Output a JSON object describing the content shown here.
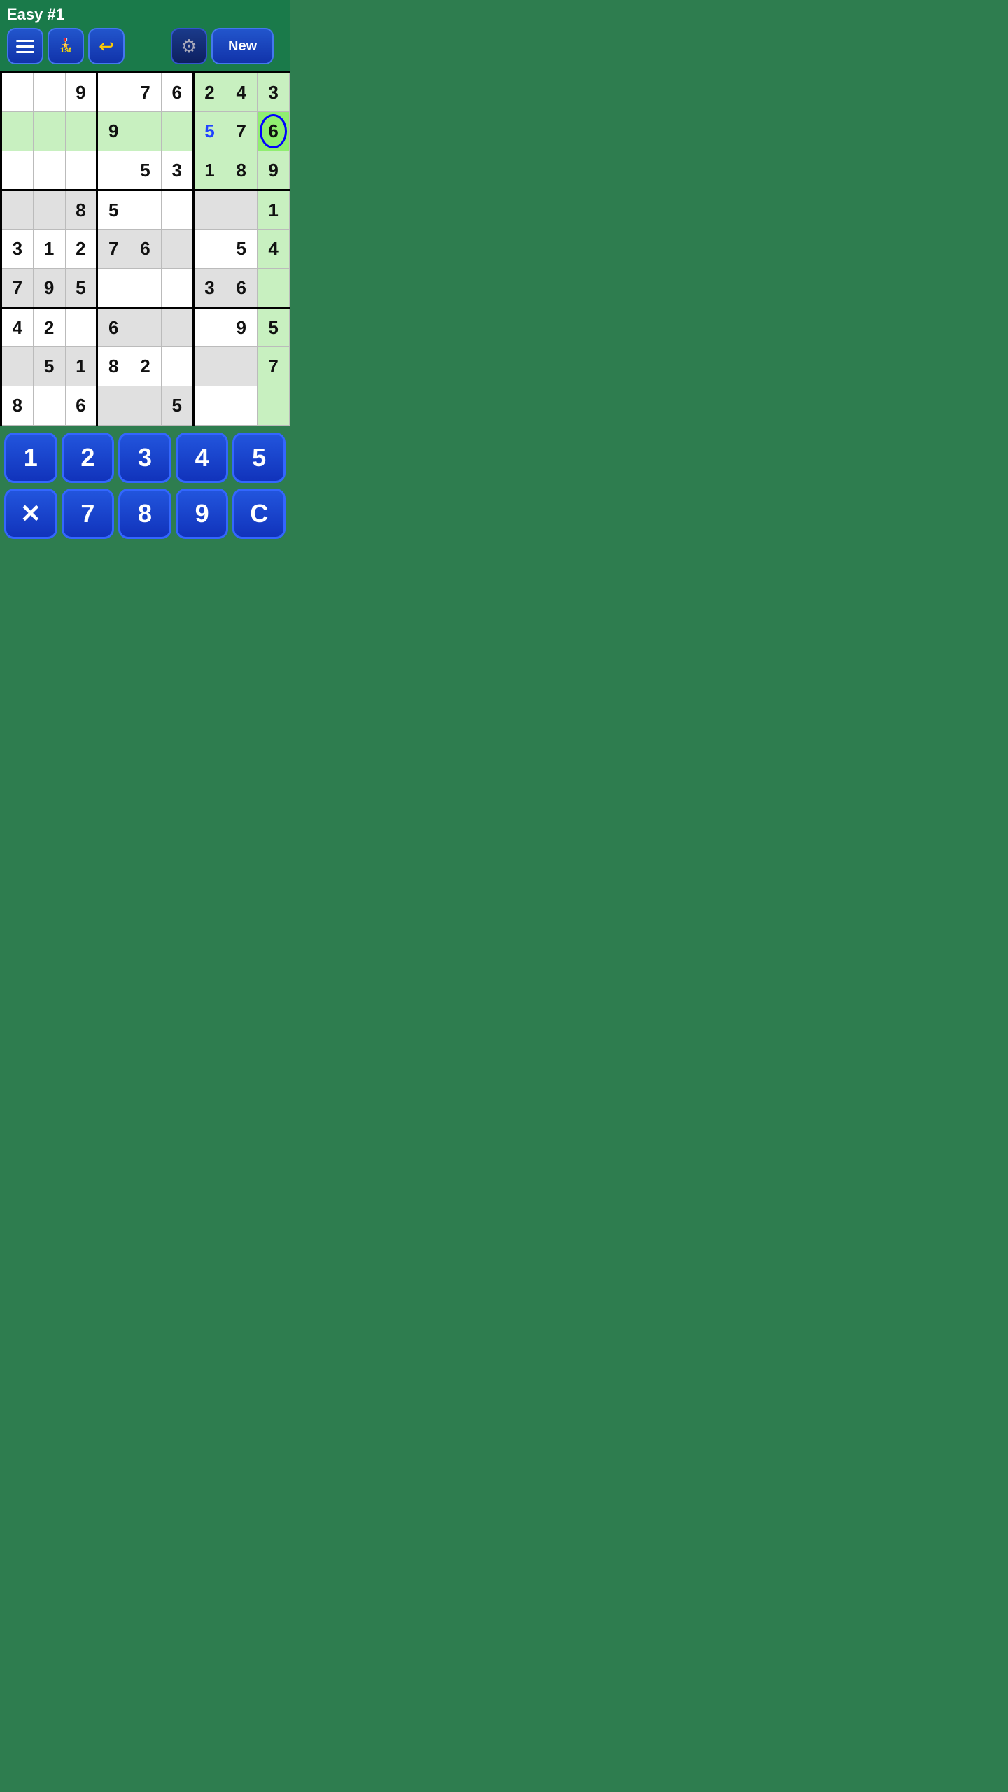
{
  "header": {
    "title": "Easy #1",
    "buttons": {
      "menu_label": "menu",
      "medal_label": "1st",
      "undo_label": "undo",
      "gear_label": "settings",
      "new_label": "New"
    }
  },
  "grid": {
    "rows": [
      [
        {
          "val": "",
          "bg": "white"
        },
        {
          "val": "",
          "bg": "white"
        },
        {
          "val": "9",
          "bg": "white"
        },
        {
          "val": "",
          "bg": "white"
        },
        {
          "val": "7",
          "bg": "white"
        },
        {
          "val": "6",
          "bg": "white"
        },
        {
          "val": "2",
          "bg": "green-light"
        },
        {
          "val": "4",
          "bg": "green-light"
        },
        {
          "val": "3",
          "bg": "green-light"
        }
      ],
      [
        {
          "val": "",
          "bg": "green-light"
        },
        {
          "val": "",
          "bg": "green-light"
        },
        {
          "val": "",
          "bg": "green-light"
        },
        {
          "val": "9",
          "bg": "green-light"
        },
        {
          "val": "",
          "bg": "green-light"
        },
        {
          "val": "",
          "bg": "green-light"
        },
        {
          "val": "5",
          "bg": "green-light",
          "color": "blue"
        },
        {
          "val": "7",
          "bg": "green-light"
        },
        {
          "val": "6",
          "bg": "green-medium",
          "selected": true
        }
      ],
      [
        {
          "val": "",
          "bg": "white"
        },
        {
          "val": "",
          "bg": "white"
        },
        {
          "val": "",
          "bg": "white"
        },
        {
          "val": "",
          "bg": "white"
        },
        {
          "val": "5",
          "bg": "white"
        },
        {
          "val": "3",
          "bg": "white"
        },
        {
          "val": "1",
          "bg": "green-light"
        },
        {
          "val": "8",
          "bg": "green-light"
        },
        {
          "val": "9",
          "bg": "green-light"
        }
      ],
      [
        {
          "val": "",
          "bg": "gray"
        },
        {
          "val": "",
          "bg": "gray"
        },
        {
          "val": "8",
          "bg": "gray"
        },
        {
          "val": "5",
          "bg": "white"
        },
        {
          "val": "",
          "bg": "white"
        },
        {
          "val": "",
          "bg": "white"
        },
        {
          "val": "",
          "bg": "gray"
        },
        {
          "val": "",
          "bg": "gray"
        },
        {
          "val": "1",
          "bg": "green-light"
        }
      ],
      [
        {
          "val": "3",
          "bg": "white"
        },
        {
          "val": "1",
          "bg": "white"
        },
        {
          "val": "2",
          "bg": "white"
        },
        {
          "val": "7",
          "bg": "gray"
        },
        {
          "val": "6",
          "bg": "gray"
        },
        {
          "val": "",
          "bg": "gray"
        },
        {
          "val": "",
          "bg": "white"
        },
        {
          "val": "5",
          "bg": "white"
        },
        {
          "val": "4",
          "bg": "green-light"
        }
      ],
      [
        {
          "val": "7",
          "bg": "gray"
        },
        {
          "val": "9",
          "bg": "gray"
        },
        {
          "val": "5",
          "bg": "gray"
        },
        {
          "val": "",
          "bg": "white"
        },
        {
          "val": "",
          "bg": "white"
        },
        {
          "val": "",
          "bg": "white"
        },
        {
          "val": "3",
          "bg": "gray"
        },
        {
          "val": "6",
          "bg": "gray"
        },
        {
          "val": "",
          "bg": "green-light"
        }
      ],
      [
        {
          "val": "4",
          "bg": "white"
        },
        {
          "val": "2",
          "bg": "white"
        },
        {
          "val": "",
          "bg": "white"
        },
        {
          "val": "6",
          "bg": "gray"
        },
        {
          "val": "",
          "bg": "gray"
        },
        {
          "val": "",
          "bg": "gray"
        },
        {
          "val": "",
          "bg": "white"
        },
        {
          "val": "9",
          "bg": "white"
        },
        {
          "val": "5",
          "bg": "green-light"
        }
      ],
      [
        {
          "val": "",
          "bg": "gray"
        },
        {
          "val": "5",
          "bg": "gray"
        },
        {
          "val": "1",
          "bg": "gray"
        },
        {
          "val": "8",
          "bg": "white"
        },
        {
          "val": "2",
          "bg": "white"
        },
        {
          "val": "",
          "bg": "white"
        },
        {
          "val": "",
          "bg": "gray"
        },
        {
          "val": "",
          "bg": "gray"
        },
        {
          "val": "7",
          "bg": "green-light"
        }
      ],
      [
        {
          "val": "8",
          "bg": "white"
        },
        {
          "val": "",
          "bg": "white"
        },
        {
          "val": "6",
          "bg": "white"
        },
        {
          "val": "",
          "bg": "gray"
        },
        {
          "val": "",
          "bg": "gray"
        },
        {
          "val": "5",
          "bg": "gray"
        },
        {
          "val": "",
          "bg": "white"
        },
        {
          "val": "",
          "bg": "white"
        },
        {
          "val": "",
          "bg": "green-light"
        }
      ]
    ]
  },
  "numpad": {
    "row1": [
      "1",
      "2",
      "3",
      "4",
      "5"
    ],
    "row2": [
      "✕",
      "7",
      "8",
      "9",
      "C"
    ]
  },
  "colors": {
    "header_bg": "#1a7a4a",
    "body_bg": "#2e7d4f",
    "green_light": "#c8f0c0",
    "green_medium": "#90ee70",
    "gray": "#e0e0e0",
    "btn_blue": "#1e44cc"
  }
}
